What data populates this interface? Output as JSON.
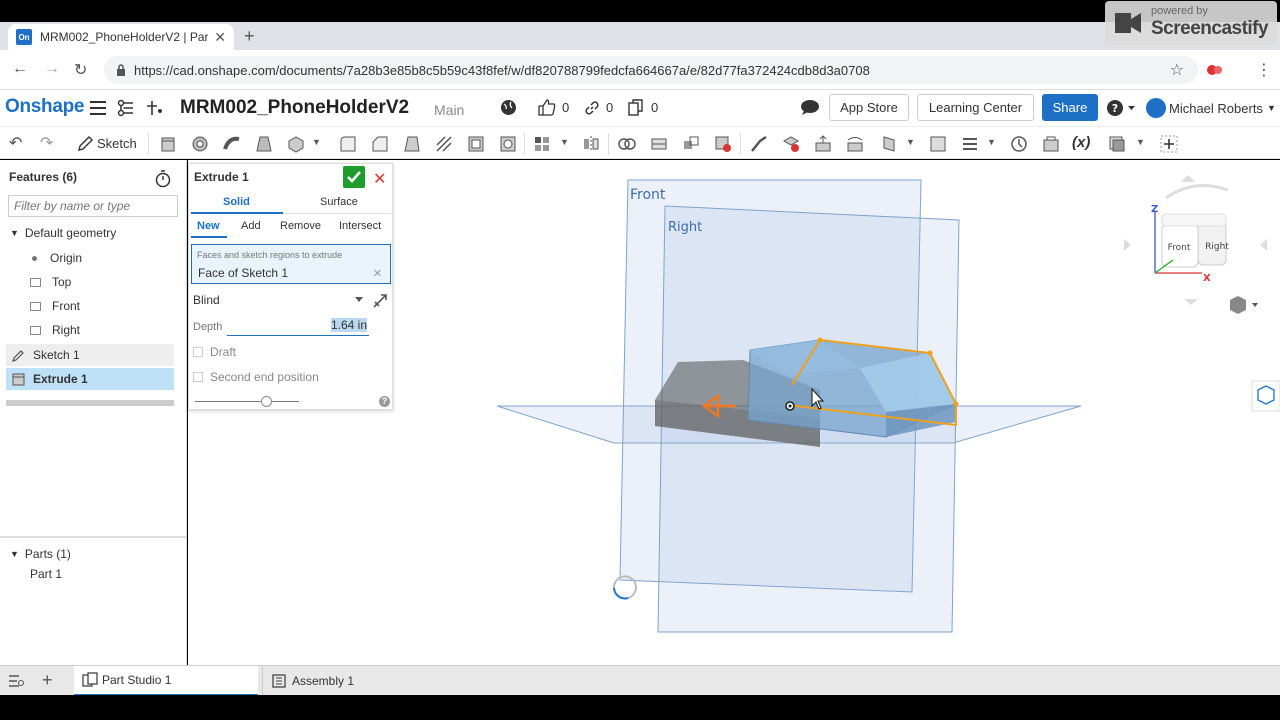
{
  "browser": {
    "tab_title": "MRM002_PhoneHolderV2 | Part",
    "favicon_text": "On",
    "url": "https://cad.onshape.com/documents/7a28b3e85b8c5b59c43f8fef/w/df820788799fedcfa664667a/e/82d77fa372424cdb8d3a0708"
  },
  "watermark": {
    "line1": "powered by",
    "line2": "Screencastify"
  },
  "header": {
    "brand": "Onshape",
    "doc_title": "MRM002_PhoneHolderV2",
    "branch": "Main",
    "likes": "0",
    "links": "0",
    "copies": "0",
    "app_store": "App Store",
    "learning_center": "Learning Center",
    "share": "Share",
    "user": "Michael Roberts"
  },
  "toolbar": {
    "sketch_label": "Sketch"
  },
  "features": {
    "title": "Features (6)",
    "filter_placeholder": "Filter by name or type",
    "default_geometry": "Default geometry",
    "items": [
      "Origin",
      "Top",
      "Front",
      "Right",
      "Sketch 1",
      "Extrude 1"
    ],
    "parts_title": "Parts (1)",
    "parts": [
      "Part 1"
    ]
  },
  "dialog": {
    "title": "Extrude 1",
    "tab_solid": "Solid",
    "tab_surface": "Surface",
    "op_new": "New",
    "op_add": "Add",
    "op_remove": "Remove",
    "op_intersect": "Intersect",
    "selection_hint": "Faces and sketch regions to extrude",
    "selection_value": "Face of Sketch 1",
    "end_type": "Blind",
    "depth_label": "Depth",
    "depth_value": "1.64 in",
    "draft_label": "Draft",
    "second_end_label": "Second end position",
    "help": "?"
  },
  "viewport": {
    "plane_front": "Front",
    "plane_right": "Right",
    "cube_front": "Front",
    "cube_right": "Right",
    "axis_z": "Z",
    "axis_x": "X"
  },
  "bottom": {
    "tab1": "Part Studio 1",
    "tab2": "Assembly 1"
  },
  "colors": {
    "brand": "#1d70c5",
    "selection": "#bfe1f7",
    "highlight": "#f0a020",
    "ok": "#1e9c2c"
  }
}
